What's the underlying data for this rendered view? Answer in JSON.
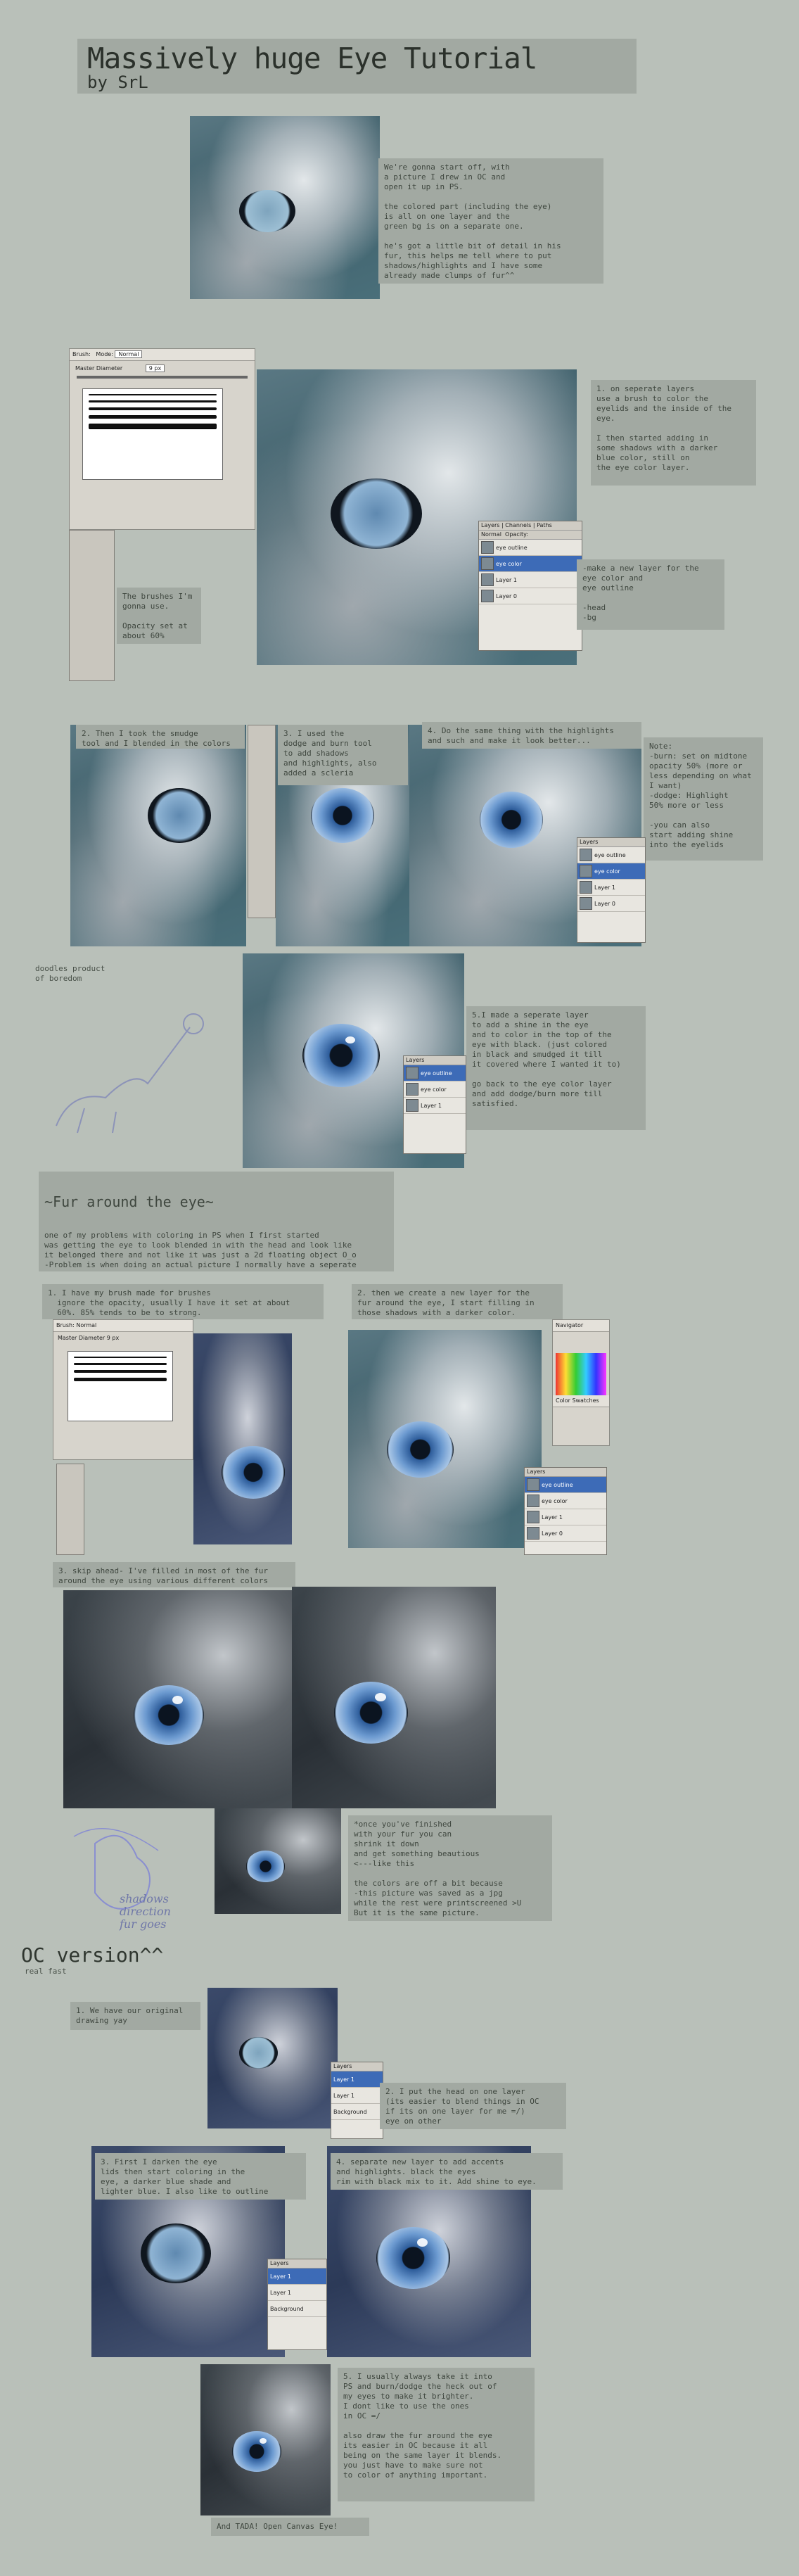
{
  "header": {
    "title": "Massively huge Eye Tutorial",
    "byline": "by SrL"
  },
  "notes": {
    "intro": "We're gonna start off, with\na picture I drew in OC and\nopen it up in PS.\n\nthe colored part (including the eye)\nis all on one layer and the\ngreen bg is on a separate one.\n\nhe's got a little bit of detail in his\nfur, this helps me tell where to put\nshadows/highlights and I have some\nalready made clumps of fur^^",
    "step1": "1. on seperate layers\nuse a brush to color the\neyelids and the inside of the\neye.\n\nI then started adding in\nsome shadows with a darker\nblue color, still on\nthe eye color layer.",
    "layer_note": "-make a new layer for the\neye color and\neye outline\n\n-head\n-bg",
    "brushes": "The brushes I'm\ngonna use.\n\nOpacity set at\nabout 60%\nor so.",
    "step2": "2. Then I took the smudge\ntool and I blended in the colors",
    "step3": "3. I used the\ndodge and burn tool\nto add shadows\nand highlights, also\nadded a scleria",
    "step4": "4. Do the same thing with the highlights\nand such and make it look better...",
    "dodge_burn": "Note:\n-burn: set on midtone\nopacity 50% (more or\nless depending on what\nI want)\n-dodge: Highlight\n50% more or less\n\n-you can also\nstart adding shine\ninto the eyelids",
    "doodle_caption": "doodles product\nof boredom",
    "step5": "5.I made a seperate layer\nto add a shine in the eye\nand to color in the top of the\neye with black. (just colored\nin black and smudged it till\nit covered where I wanted it to)\n\ngo back to the eye color layer\nand add dodge/burn more till\nsatisfied.",
    "fur_title": "~Fur around the eye~",
    "fur_intro": "one of my problems with coloring in PS when I first started\nwas getting the eye to look blended in with the head and look like\nit belonged there and not like it was just a 2d floating object O_o\n-Problem is when doing an actual picture I normally have a seperate\nlayer for fur and then a \"fur around eye\" layer..so you\nhave to make sure both layers blend with each other.\n(later on I might just merge all the head and eye layers\nbut right now they would be seperated)",
    "fur1": "1. I have my brush made for brushes\n  ignore the opacity, usually I have it set at about\n  60%. 85% tends to be to strong.",
    "fur2": "2. then we create a new layer for the\nfur around the eye, I start filling in\nthose shadows with a darker color.",
    "fur3": "3. skip ahead- I've filled in most of the fur\naround the eye using various different colors",
    "finish": "*once you've finished\nwith your fur you can\nshrink it down\nand get something beautious\n<---like this\n\nthe colors are off a bit because\n-this picture was saved as a jpg\nwhile the rest were printscreened >U\nBut it is the same picture.",
    "shadows_doodle": "shadows\ndirection\nfur goes",
    "oc_title": "OC version^^",
    "oc_sub": "real fast",
    "oc1": "1. We have our original\ndrawing yay",
    "oc2": "2. I put the head on one layer\n(its easier to blend things in OC\nif its on one layer for me =/)\neye on other",
    "oc3": "3. First I darken the eye\nlids then start coloring in the\neye, a darker blue shade and\nlighter blue. I also like to outline\nmy eye",
    "oc4": "4. separate new layer to add accents\nand highlights. black the eyes\nrim with black mix to it. Add shine to eye.",
    "oc5": "5. I usually always take it into\nPS and burn/dodge the heck out of\nmy eyes to make it brighter.\nI dont like to use the ones\nin OC =/\n\nalso draw the fur around the eye\nits easier in OC because it all\nbeing on the same layer it blends.\nyou just have to make sure not\nto color of anything important.",
    "ending": "And TADA! Open Canvas Eye!"
  },
  "ui": {
    "brush_label": "Brush:",
    "mode_label": "Mode:",
    "mode_value": "Normal",
    "master_diameter": "Master Diameter",
    "diameter_value": "9 px",
    "layers_tab": "Layers",
    "channels_tab": "Channels",
    "paths_tab": "Paths",
    "blend_mode": "Normal",
    "opacity_label": "Opacity:",
    "layer_names": [
      "eye outline",
      "eye color",
      "Layer 1",
      "Layer 0"
    ],
    "oc_layer_names": [
      "Layer 1",
      "Layer 1",
      "Background"
    ],
    "navigator_tab": "Navigator",
    "color_tab": "Color",
    "swatches_tab": "Swatches"
  },
  "colors": {
    "page_bg": "#b9c0b9",
    "note_bg": "#a2a9a2",
    "text": "#3e463e",
    "eye_blue": "#6c9ad0",
    "selected_layer": "#3d6bb7"
  }
}
